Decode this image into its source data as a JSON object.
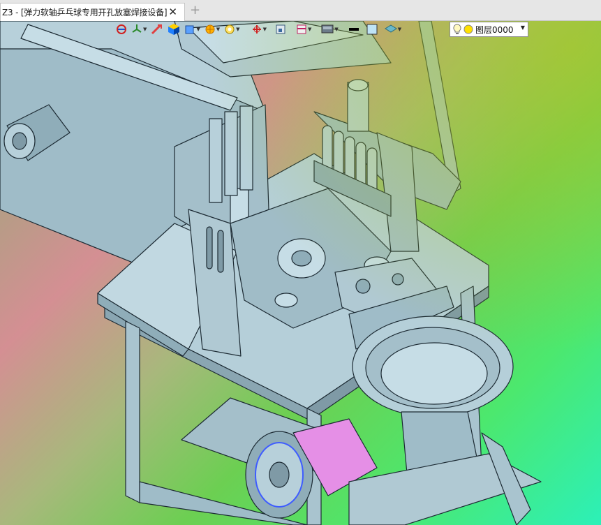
{
  "window": {
    "tab_title": "Z3 - [弹力软轴乒乓球专用开孔放塞焊接设备]",
    "close_glyph": "✕",
    "new_tab_glyph": "+"
  },
  "toolbar": {
    "icons": [
      "view-orient-icon",
      "axis-triad-icon",
      "move-arrow-icon",
      "shaded-cube-icon",
      "render-style-icon",
      "sun-icon",
      "zoom-icon",
      "spin-icon",
      "window-fit-icon",
      "section-plane-icon",
      "display-mode-icon",
      "line-color-swatch",
      "fill-color-swatch",
      "layer-visibility-icon"
    ],
    "line_color": "#000000",
    "fill_color": "#bfe3f5"
  },
  "layer": {
    "name": "图层0000",
    "bulb_icon": "lightbulb-icon",
    "dot_color": "#ffe000"
  },
  "colors": {
    "part_fill": "#a9c4cf",
    "part_dark": "#7f9aa6",
    "part_light": "#c6dde6",
    "edge": "#1c2a33",
    "magenta_part": "#e58fe6",
    "blue_part": "#3e5cff"
  }
}
